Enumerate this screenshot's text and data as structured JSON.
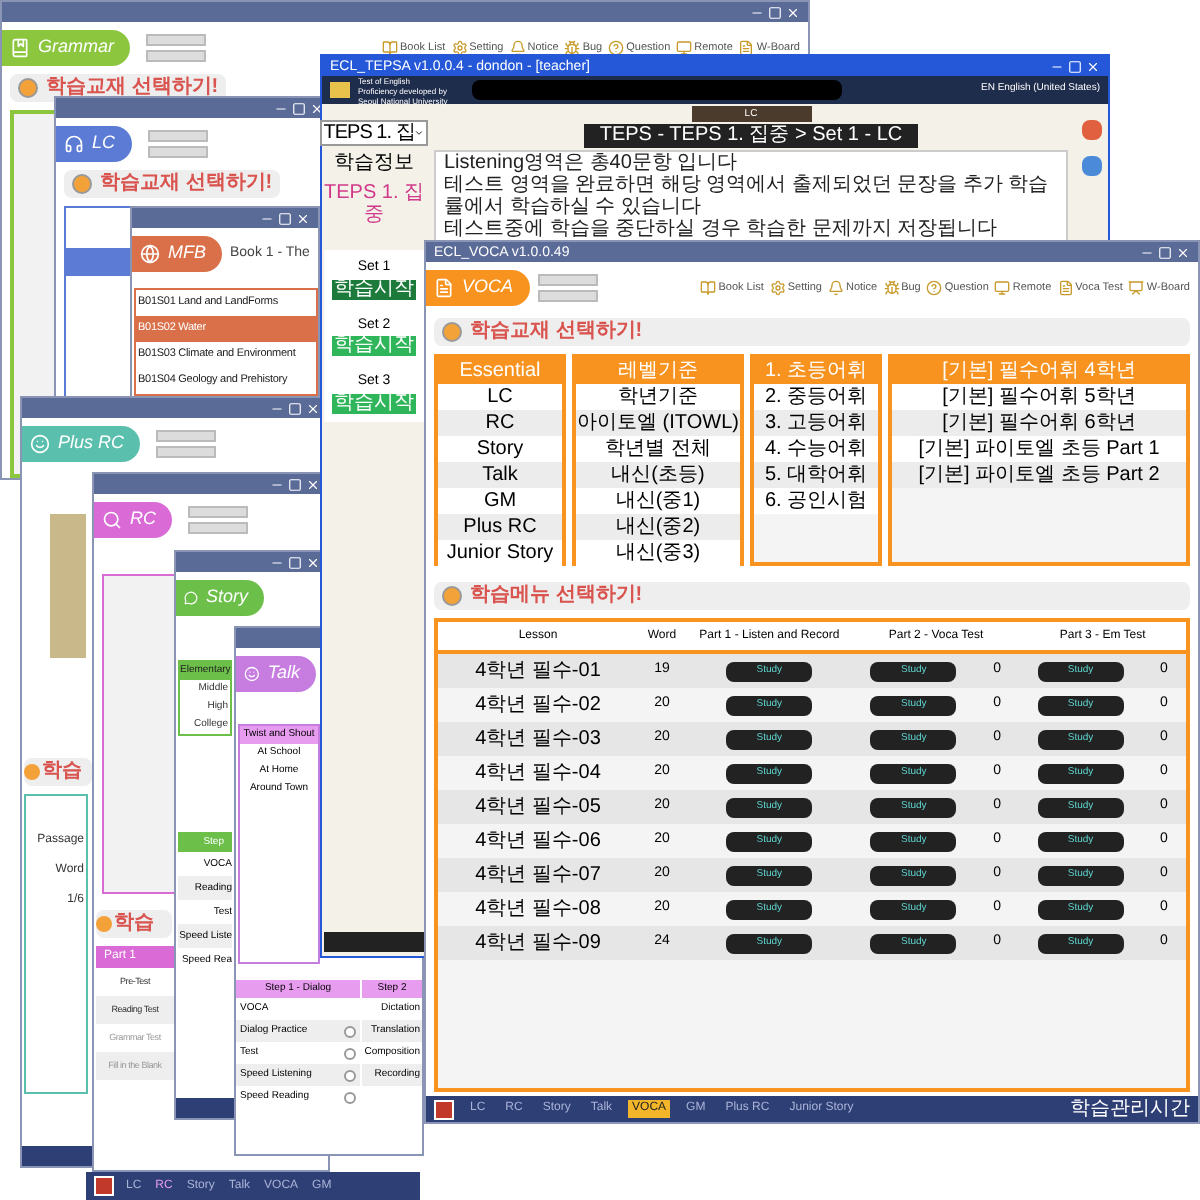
{
  "grammar_window": {
    "logo": "Grammar",
    "toolbar": [
      "Book List",
      "Setting",
      "Notice",
      "Bug",
      "Question",
      "Remote",
      "W-Board"
    ],
    "banner": "학습교재 선택하기!"
  },
  "lc_window": {
    "logo": "LC",
    "banner": "학습교재 선택하기!"
  },
  "mfb_window": {
    "logo": "MFB",
    "book": "Book 1 - The",
    "lessons": [
      {
        "label": "B01S01 Land and LandForms",
        "selected": false
      },
      {
        "label": "B01S02 Water",
        "selected": true
      },
      {
        "label": "B01S03 Climate and Environment",
        "selected": false
      },
      {
        "label": "B01S04 Geology and Prehistory",
        "selected": false
      }
    ]
  },
  "plus_rc_window": {
    "logo": "Plus RC",
    "banner": "학습",
    "menu": [
      "Passage",
      "Word",
      "1/6"
    ]
  },
  "rc_window": {
    "logo": "RC",
    "banner": "학습",
    "part": "Part 1",
    "steps": [
      {
        "label": "Pre-Test",
        "disabled": false
      },
      {
        "label": "Reading Test",
        "disabled": false
      },
      {
        "label": "Grammar Test",
        "disabled": true
      },
      {
        "label": "Fill in the Blank",
        "disabled": true
      }
    ]
  },
  "story_window": {
    "logo": "Story",
    "levels": [
      {
        "label": "Elementary",
        "selected": true
      },
      {
        "label": "Middle",
        "selected": false
      },
      {
        "label": "High",
        "selected": false
      },
      {
        "label": "College",
        "selected": false
      }
    ],
    "step": "Step",
    "steps": [
      "VOCA",
      "Reading",
      "Test",
      "Speed Liste",
      "Speed Rea"
    ]
  },
  "talk_window": {
    "logo": "Talk",
    "topics": [
      {
        "label": "Twist and Shout",
        "selected": true
      },
      {
        "label": "At School",
        "selected": false
      },
      {
        "label": "At Home",
        "selected": false
      },
      {
        "label": "Around Town",
        "selected": false
      }
    ],
    "step1": "Step 1 - Dialog",
    "step1_items": [
      {
        "label": "VOCA",
        "kind": "plain"
      },
      {
        "label": "Dialog Practice",
        "kind": "check",
        "checked": false
      },
      {
        "label": "Test",
        "kind": "check",
        "checked": false
      },
      {
        "label": "Speed Listening",
        "kind": "check",
        "checked": false
      },
      {
        "label": "Speed Reading",
        "kind": "check",
        "checked": false
      }
    ],
    "step2": "Step 2",
    "step2_items": [
      "Dictation",
      "Translation",
      "Composition",
      "Recording"
    ]
  },
  "teps_window": {
    "title": "ECL_TEPSA v1.0.0.4 - dondon - [teacher]",
    "org": "Test of English Proficiency developed by Seoul National University",
    "language": "EN English (United States)",
    "select": "TEPS 1. 집",
    "info_label": "학습정보",
    "info_value": "TEPS 1. 집중",
    "sets": [
      {
        "label": "Set 1",
        "button": "학습시작",
        "selected": true
      },
      {
        "label": "Set 2",
        "button": "학습시작",
        "selected": false
      },
      {
        "label": "Set 3",
        "button": "학습시작",
        "selected": false
      }
    ],
    "section_tab": "LC",
    "breadcrumb": "TEPS - TEPS 1. 집중 > Set 1 - LC",
    "instructions": [
      "Listening영역은 총40문항 입니다",
      "테스트 영역을 완료하면 해당 영역에서 출제되었던 문장을 추가 학습률에서 학습하실 수 있습니다",
      "테스트중에 학습을 중단하실 경우 학습한 문제까지 저장됩니다"
    ]
  },
  "voca_window": {
    "title": "ECL_VOCA v1.0.0.49",
    "logo": "VOCA",
    "toolbar": [
      "Book List",
      "Setting",
      "Notice",
      "Bug",
      "Question",
      "Remote",
      "Voca Test",
      "W-Board"
    ],
    "banner1": "학습교재 선택하기!",
    "banner2": "학습메뉴 선택하기!",
    "lists": [
      [
        {
          "label": "Essential",
          "selected": true
        },
        {
          "label": "LC",
          "selected": false
        },
        {
          "label": "RC",
          "selected": false
        },
        {
          "label": "Story",
          "selected": false
        },
        {
          "label": "Talk",
          "selected": false
        },
        {
          "label": "GM",
          "selected": false
        },
        {
          "label": "Plus RC",
          "selected": false
        },
        {
          "label": "Junior Story",
          "selected": false
        }
      ],
      [
        {
          "label": "레벨기준",
          "selected": true
        },
        {
          "label": "학년기준",
          "selected": false
        },
        {
          "label": "아이토엘 (ITOWL)",
          "selected": false
        },
        {
          "label": "학년별 전체",
          "selected": false
        },
        {
          "label": "내신(초등)",
          "selected": false
        },
        {
          "label": "내신(중1)",
          "selected": false
        },
        {
          "label": "내신(중2)",
          "selected": false
        },
        {
          "label": "내신(중3)",
          "selected": false
        }
      ],
      [
        {
          "label": "1. 초등어휘",
          "selected": true
        },
        {
          "label": "2. 중등어휘",
          "selected": false
        },
        {
          "label": "3. 고등어휘",
          "selected": false
        },
        {
          "label": "4. 수능어휘",
          "selected": false
        },
        {
          "label": "5. 대학어휘",
          "selected": false
        },
        {
          "label": "6. 공인시험",
          "selected": false
        }
      ],
      [
        {
          "label": "[기본] 필수어휘 4학년",
          "selected": true
        },
        {
          "label": "[기본] 필수어휘 5학년",
          "selected": false
        },
        {
          "label": "[기본] 필수어휘 6학년",
          "selected": false
        },
        {
          "label": "[기본] 파이토엘 초등 Part 1",
          "selected": false
        },
        {
          "label": "[기본] 파이토엘 초등 Part 2",
          "selected": false
        }
      ]
    ],
    "columns": [
      "Lesson",
      "Word",
      "Part 1 - Listen and Record",
      "Part 2 - Voca Test",
      "Part 3 - Em Test"
    ],
    "rows": [
      {
        "lesson": "4학년 필수-01",
        "word": "19",
        "part1": "Study",
        "part2": "Study",
        "part2_score": "0",
        "part3": "Study",
        "part3_score": "0"
      },
      {
        "lesson": "4학년 필수-02",
        "word": "20",
        "part1": "Study",
        "part2": "Study",
        "part2_score": "0",
        "part3": "Study",
        "part3_score": "0"
      },
      {
        "lesson": "4학년 필수-03",
        "word": "20",
        "part1": "Study",
        "part2": "Study",
        "part2_score": "0",
        "part3": "Study",
        "part3_score": "0"
      },
      {
        "lesson": "4학년 필수-04",
        "word": "20",
        "part1": "Study",
        "part2": "Study",
        "part2_score": "0",
        "part3": "Study",
        "part3_score": "0"
      },
      {
        "lesson": "4학년 필수-05",
        "word": "20",
        "part1": "Study",
        "part2": "Study",
        "part2_score": "0",
        "part3": "Study",
        "part3_score": "0"
      },
      {
        "lesson": "4학년 필수-06",
        "word": "20",
        "part1": "Study",
        "part2": "Study",
        "part2_score": "0",
        "part3": "Study",
        "part3_score": "0"
      },
      {
        "lesson": "4학년 필수-07",
        "word": "20",
        "part1": "Study",
        "part2": "Study",
        "part2_score": "0",
        "part3": "Study",
        "part3_score": "0"
      },
      {
        "lesson": "4학년 필수-08",
        "word": "20",
        "part1": "Study",
        "part2": "Study",
        "part2_score": "0",
        "part3": "Study",
        "part3_score": "0"
      },
      {
        "lesson": "4학년 필수-09",
        "word": "24",
        "part1": "Study",
        "part2": "Study",
        "part2_score": "0",
        "part3": "Study",
        "part3_score": "0"
      }
    ],
    "taskbar": [
      {
        "label": "LC",
        "selected": false
      },
      {
        "label": "RC",
        "selected": false
      },
      {
        "label": "Story",
        "selected": false
      },
      {
        "label": "Talk",
        "selected": false
      },
      {
        "label": "VOCA",
        "selected": true
      },
      {
        "label": "GM",
        "selected": false
      },
      {
        "label": "Plus RC",
        "selected": false
      },
      {
        "label": "Junior Story",
        "selected": false
      }
    ],
    "clock_label": "학습관리시간"
  },
  "bottom_taskbar": [
    {
      "label": "LC",
      "selected": false
    },
    {
      "label": "RC",
      "selected": true
    },
    {
      "label": "Story",
      "selected": false
    },
    {
      "label": "Talk",
      "selected": false
    },
    {
      "label": "VOCA",
      "selected": false
    },
    {
      "label": "GM",
      "selected": false
    }
  ]
}
